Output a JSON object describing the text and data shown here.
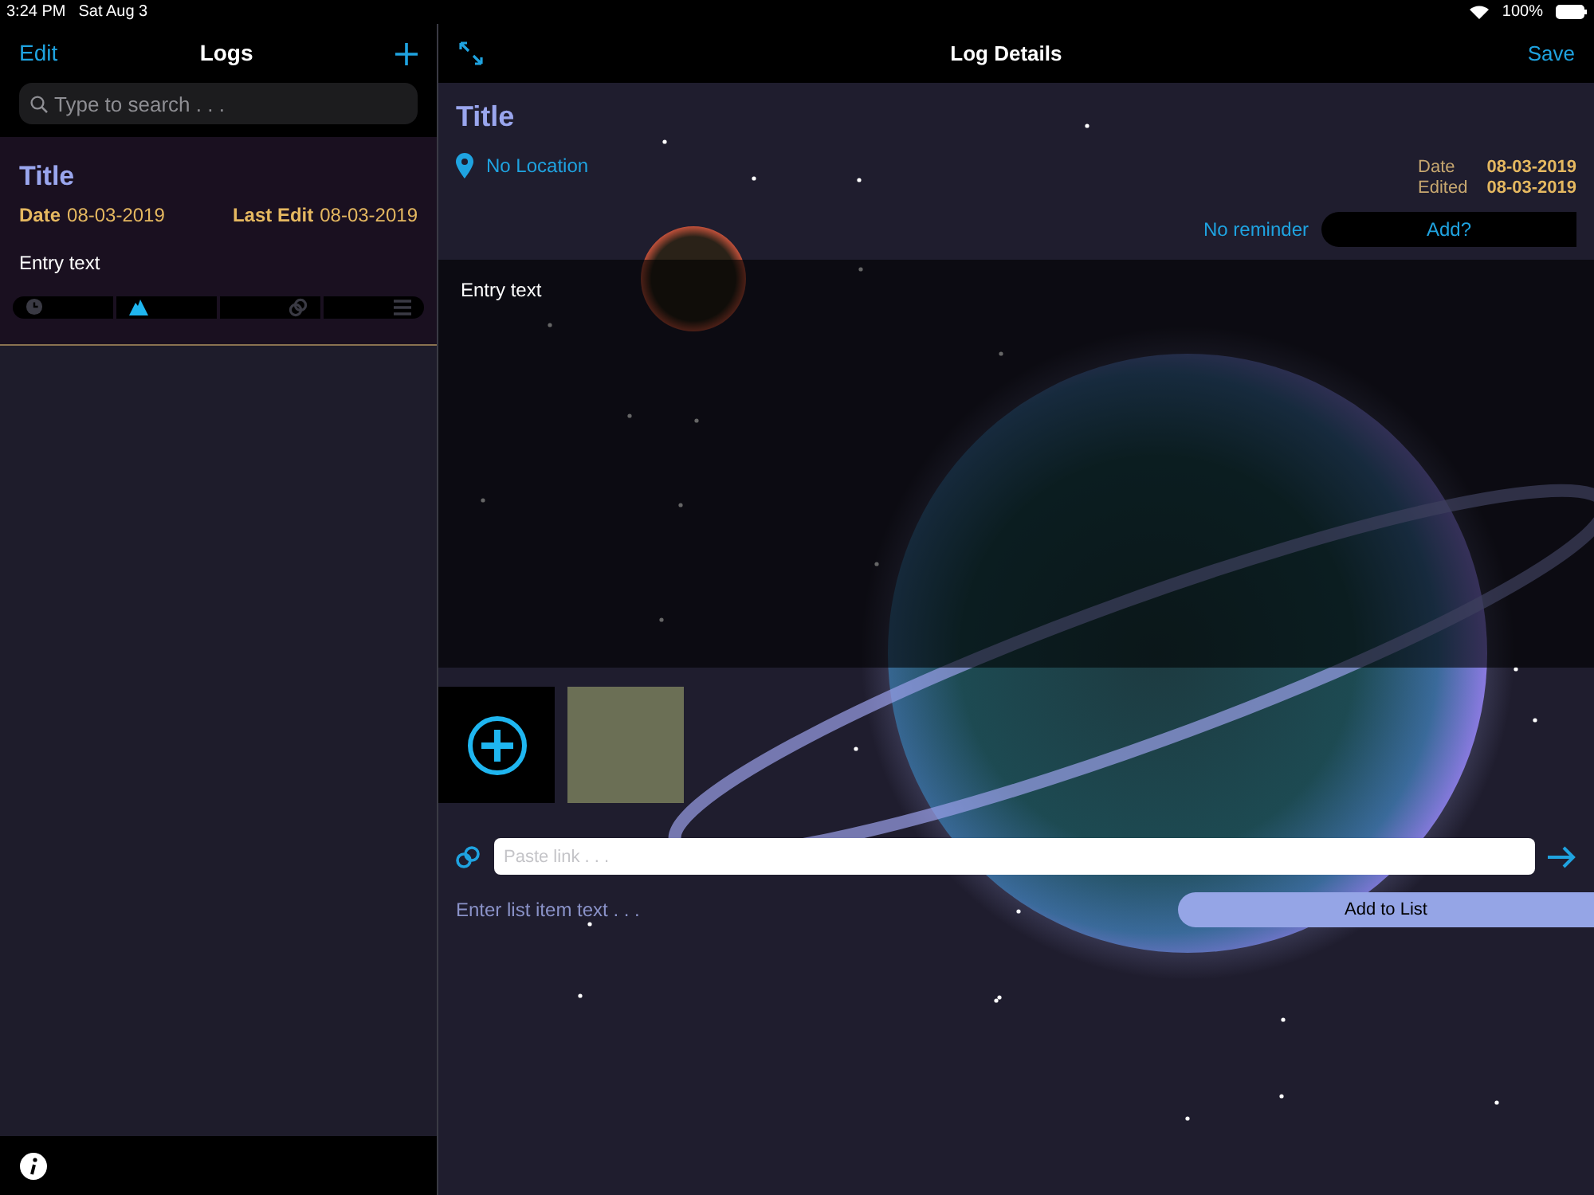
{
  "status_bar": {
    "time": "3:24 PM",
    "date": "Sat Aug 3",
    "battery": "100%"
  },
  "sidebar": {
    "edit": "Edit",
    "title": "Logs",
    "search": {
      "placeholder": "Type to search . . ."
    },
    "entries": [
      {
        "title": "Title",
        "date_label": "Date",
        "date": "08-03-2019",
        "edit_label": "Last Edit",
        "edit_date": "08-03-2019",
        "text": "Entry text",
        "selected": true,
        "segments": [
          {
            "kind": "clock",
            "selected": false
          },
          {
            "kind": "mountain",
            "selected": true
          },
          {
            "kind": "link",
            "selected": false
          },
          {
            "kind": "list",
            "selected": false
          }
        ]
      }
    ]
  },
  "detail": {
    "title": "Log Details",
    "save": "Save",
    "entry_title": "Title",
    "location": "No Location",
    "date_label": "Date",
    "date": "08-03-2019",
    "edited_label": "Edited",
    "edited": "08-03-2019",
    "reminder": "No reminder",
    "add_reminder": "Add?",
    "entry_text": "Entry text",
    "link": {
      "placeholder": "Paste link . . ."
    },
    "list_item": {
      "placeholder": "Enter list item text . . ."
    },
    "add_to_list": "Add to List"
  }
}
